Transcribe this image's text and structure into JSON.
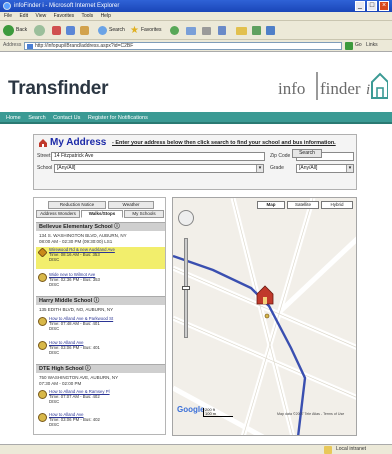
{
  "window": {
    "title": "infoFinder i - Microsoft Internet Explorer",
    "menu": [
      "File",
      "Edit",
      "View",
      "Favorites",
      "Tools",
      "Help"
    ],
    "toolbar": {
      "back": "Back",
      "search": "Search",
      "favorites": "Favorites"
    },
    "address_label": "Address",
    "address_url": "http://infopup/iBrand/address.aspx?id=C2BF",
    "go_label": "Go",
    "links_label": "Links"
  },
  "page": {
    "brand": "Transfinder",
    "logo_text": "infofinder i",
    "nav": [
      "Home",
      "Search",
      "Contact Us",
      "Register for Notifications"
    ]
  },
  "address_panel": {
    "title": "My Address",
    "hint": "- Enter your address below then click search to find your school and bus information.",
    "street_label": "Street",
    "street_value": "14 Fitzpatrick Ave",
    "zip_label": "Zip Code",
    "zip_value": "12308",
    "school_label": "School",
    "school_value": "[Any/All]",
    "grade_label": "Grade",
    "grade_value": "[Any/All]",
    "search_button": "Search"
  },
  "left_panel": {
    "top_tabs": [
      "Reduction Notice",
      "Weather"
    ],
    "tabs": [
      "Address Wonders",
      "Walks/Stops",
      "My Schools"
    ],
    "active_tab": 1,
    "schools": [
      {
        "name": "Bellevue Elementary School",
        "address": "134 S. WASHINGTON BLVD, AUBURN, NY",
        "hours": "08:00 AM - 02:30 PM  (09:30:00) LS1",
        "stops": [
          {
            "title": "Wirewood Rd & new Auckland Ave",
            "line2": "Time: 08:16 AM - Bus: 353",
            "line3": "DISC",
            "highlight": true,
            "icon": "bus"
          },
          {
            "title": "Wide new to Wilmot Ave",
            "line2": "Time: 02:36 PM - Bus: 353",
            "line3": "DISC",
            "highlight": false,
            "icon": "bus"
          }
        ]
      },
      {
        "name": "Harry Middle School",
        "address": "135 EDITH BLVD, NO, AUBURN, NY",
        "hours": "",
        "stops": [
          {
            "title": "How to Alland Ave & Parkwood St",
            "line2": "Time: 07:48 AM - Bus: 401",
            "line3": "DISC",
            "highlight": false,
            "icon": "bus"
          },
          {
            "title": "How to Alland Ave",
            "line2": "Time: 03:06 PM - Bus: 401",
            "line3": "DISC",
            "highlight": false,
            "icon": "bus"
          }
        ]
      },
      {
        "name": "DTE High School",
        "address": "750 WASHINGTON AVE, AUBURN, NY",
        "hours": "07:30 AM - 02:00 PM",
        "stops": [
          {
            "title": "How to Alland Ave & Ramsey Pl",
            "line2": "Time: 07:07 AM - Bus: 402",
            "line3": "DISC",
            "highlight": false,
            "icon": "bus"
          },
          {
            "title": "How to Alland Ave",
            "line2": "Time: 03:06 PM - Bus: 402",
            "line3": "DISC",
            "highlight": false,
            "icon": "bus"
          }
        ]
      }
    ]
  },
  "map": {
    "tabs": [
      "Map",
      "Satellite",
      "Hybrid"
    ],
    "active_tab": 0,
    "google_logo": "Google",
    "scale_text": "200 ft\n100 m",
    "copyright": "Map data ©2007 Tele Atlas - Terms of Use"
  },
  "status": {
    "left": "",
    "right": "Local intranet"
  },
  "colors": {
    "nav_teal": "#3b9a94",
    "title_blue": "#1c2aa8",
    "highlight": "#f2ee6c",
    "route_blue": "#3a4fb0"
  }
}
